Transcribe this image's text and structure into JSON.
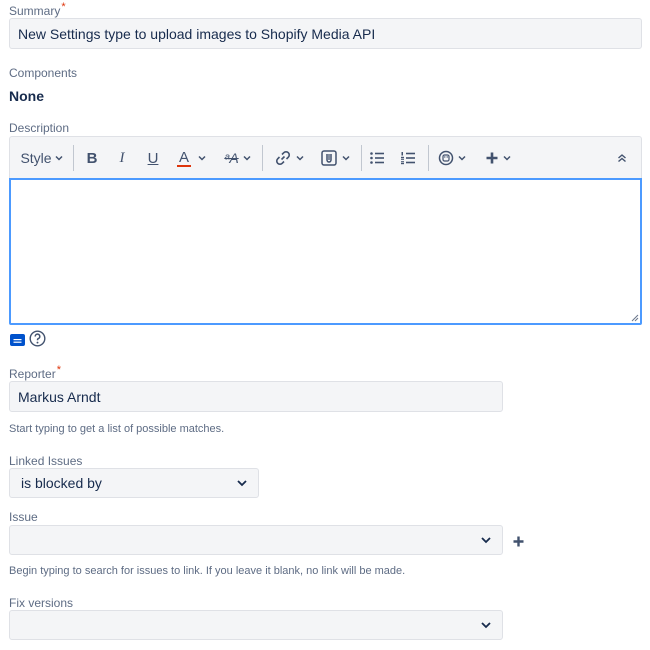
{
  "summary": {
    "label": "Summary",
    "required": "*",
    "value": "New Settings type to upload images to Shopify Media API"
  },
  "components": {
    "label": "Components",
    "value": "None"
  },
  "description": {
    "label": "Description",
    "toolbar": {
      "style_label": "Style",
      "bold": "B",
      "italic": "I",
      "underline": "U",
      "text_color": "A",
      "text_color_accent": "#de350b",
      "more_format": "ᵃA"
    }
  },
  "reporter": {
    "label": "Reporter",
    "required": "*",
    "value": "Markus Arndt",
    "hint": "Start typing to get a list of possible matches."
  },
  "linked_issues": {
    "label": "Linked Issues",
    "value": "is blocked by"
  },
  "issue": {
    "label": "Issue",
    "value": "",
    "hint": "Begin typing to search for issues to link. If you leave it blank, no link will be made."
  },
  "fix_versions": {
    "label": "Fix versions",
    "value": ""
  }
}
